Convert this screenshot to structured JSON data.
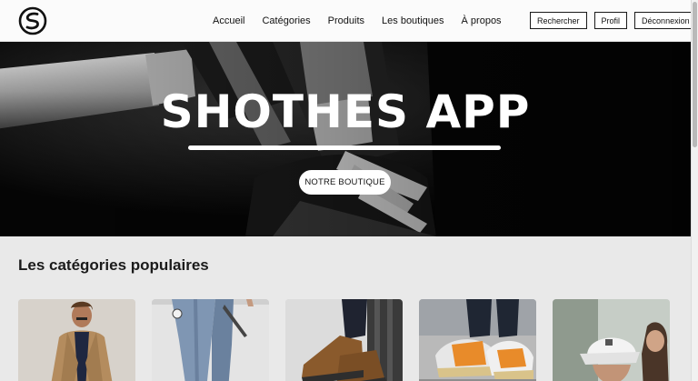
{
  "app": {
    "logo_icon": "shothes-logo-icon"
  },
  "nav": {
    "links": [
      "Accueil",
      "Catégories",
      "Produits",
      "Les boutiques",
      "À propos"
    ]
  },
  "actions": {
    "search_label": "Rechercher",
    "profile_label": "Profil",
    "logout_label": "Déconnexion"
  },
  "hero": {
    "title": "SHOTHES APP",
    "cta_label": "NOTRE BOUTIQUE"
  },
  "categories": {
    "title": "Les catégories populaires",
    "cards": [
      {
        "image": "man-in-coat-photo"
      },
      {
        "image": "jeans-photo"
      },
      {
        "image": "boots-photo"
      },
      {
        "image": "sneakers-photo"
      },
      {
        "image": "cap-photo"
      }
    ]
  },
  "colors": {
    "accent": "#111111",
    "hero_background": "#080808",
    "page_background": "#e9e9e9"
  }
}
